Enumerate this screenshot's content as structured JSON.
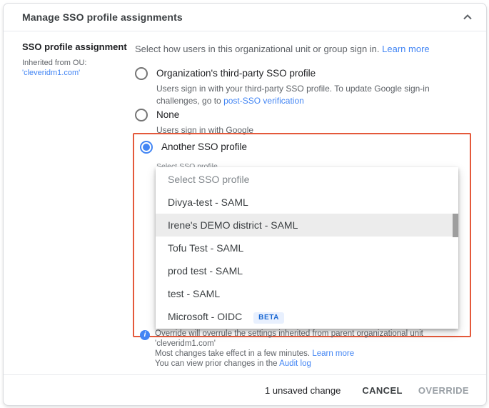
{
  "colors": {
    "accent_blue": "#4285f4",
    "highlight_border": "#e4593b",
    "beta_text": "#1967d2",
    "beta_bg": "#e8f0fe"
  },
  "header": {
    "title": "Manage SSO profile assignments"
  },
  "sidebar": {
    "title": "SSO profile assignment",
    "inherited_label": "Inherited from OU:",
    "inherited_ou": "'cleveridm1.com'"
  },
  "intro": {
    "text": "Select how users in this organizational unit or group sign in.",
    "learn_more": "Learn more"
  },
  "options": {
    "org_sso": {
      "label": "Organization's third-party SSO profile",
      "desc": "Users sign in with your third-party SSO profile. To update Google sign-in challenges, go to",
      "desc_link": "post-SSO verification"
    },
    "none": {
      "label": "None",
      "desc": "Users sign in with Google"
    },
    "another": {
      "label": "Another SSO profile",
      "select_label": "Select SSO profile"
    }
  },
  "dropdown": {
    "items": [
      {
        "label": "Select SSO profile"
      },
      {
        "label": "Divya-test - SAML"
      },
      {
        "label": "Irene's DEMO district - SAML"
      },
      {
        "label": "Tofu Test - SAML"
      },
      {
        "label": "prod test - SAML"
      },
      {
        "label": "test - SAML"
      },
      {
        "label": "Microsoft - OIDC",
        "badge": "BETA"
      }
    ]
  },
  "info": {
    "line1": "Override will overrule the settings inherited from parent organizational unit 'cleveridm1.com'",
    "line2": "Most changes take effect in a few minutes.",
    "line2_link": "Learn more",
    "line3": "You can view prior changes in the",
    "line3_link": "Audit log"
  },
  "footer": {
    "unsaved": "1 unsaved change",
    "cancel": "CANCEL",
    "override": "OVERRIDE"
  }
}
